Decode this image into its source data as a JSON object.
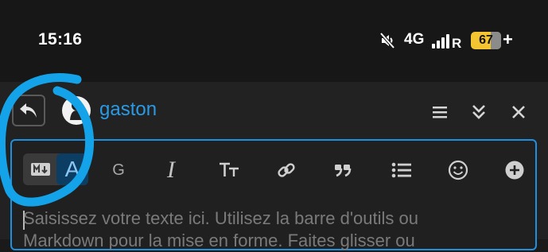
{
  "status_bar": {
    "time": "15:16",
    "network": "4G",
    "signal_suffix": "R",
    "battery_level": "67",
    "battery_fraction": 0.67,
    "charging_symbol": "+"
  },
  "header": {
    "username": "gaston",
    "icons": [
      "reply-icon",
      "avatar",
      "menu-icon",
      "collapse-icon",
      "close-icon"
    ]
  },
  "toolbar": {
    "rich_text_label": "A",
    "heading_label": "G",
    "italic_label": "I",
    "icons": [
      "markdown-icon",
      "text-size-icon",
      "link-icon",
      "quote-icon",
      "bullet-list-icon",
      "emoji-icon",
      "add-icon"
    ]
  },
  "editor": {
    "placeholder_line1": "Saisissez votre texte ici. Utilisez la barre d'outils ou",
    "placeholder_line2": "Markdown pour la mise en forme. Faites glisser ou"
  },
  "colors": {
    "accent": "#1f8fe0",
    "username": "#2b9ae5",
    "annotation": "#14a3e8",
    "battery": "#f4c431"
  }
}
